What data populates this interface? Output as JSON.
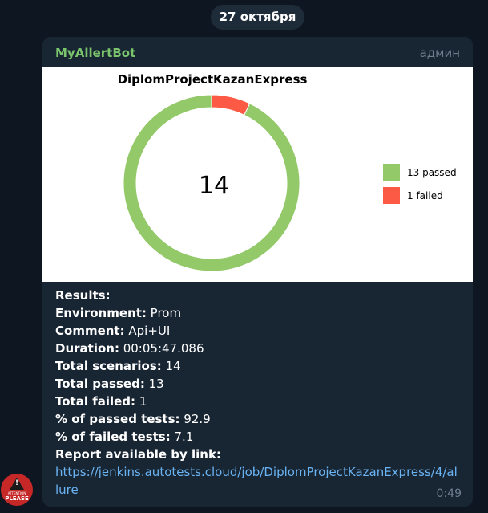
{
  "date_label": "27 октября",
  "message": {
    "sender": "MyAllertBot",
    "role": "админ",
    "time": "0:49",
    "lines": [
      {
        "label": "Results:",
        "value": ""
      },
      {
        "label": "Environment:",
        "value": " Prom"
      },
      {
        "label": "Comment:",
        "value": " Api+UI"
      },
      {
        "label": "Duration:",
        "value": " 00:05:47.086"
      },
      {
        "label": "Total scenarios:",
        "value": " 14"
      },
      {
        "label": "Total passed:",
        "value": " 13"
      },
      {
        "label": "Total failed:",
        "value": " 1"
      },
      {
        "label": "% of passed tests:",
        "value": " 92.9"
      },
      {
        "label": "% of failed tests:",
        "value": " 7.1"
      },
      {
        "label": "Report available by link:",
        "value": ""
      }
    ],
    "link": "https://jenkins.autotests.cloud/job/DiplomProjectKazanExpress/4/allure"
  },
  "avatar": {
    "top_text": "ATTENTION",
    "bottom_text": "PLEASE"
  },
  "chart_data": {
    "type": "pie",
    "title": "DiplomProjectKazanExpress",
    "center_label": "14",
    "slices": [
      {
        "name": "13 passed",
        "value": 13,
        "color": "#94c96a"
      },
      {
        "name": "1 failed",
        "value": 1,
        "color": "#fc5a45"
      }
    ],
    "legend_position": "right"
  }
}
